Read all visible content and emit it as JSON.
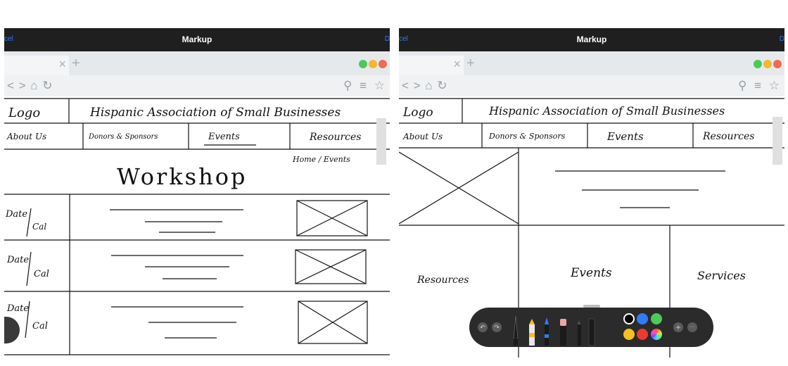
{
  "app_title": "Markup",
  "cancel_label": "cel",
  "done_label": "D",
  "colors": {
    "accent": "#2f7cf6",
    "topbar": "#1f1f1f",
    "tabstrip": "#e6e9ec"
  },
  "browser": {
    "tab_close": "×",
    "new_tab": "+",
    "nav_icons": "< > ⌂ ↻",
    "right_icons": "⚲ ≡ ☆",
    "window_dots": [
      "#4cc95a",
      "#f5b630",
      "#f06a55"
    ]
  },
  "left_wireframe": {
    "logo": "Logo",
    "site_title": "Hispanic Association of Small Businesses",
    "nav": [
      "About Us",
      "Donors & Sponsors",
      "Events",
      "Resources"
    ],
    "breadcrumb": "Home / Events",
    "page_heading": "Workshop",
    "rows": [
      {
        "date": "Date",
        "cal": "Cal"
      },
      {
        "date": "Date",
        "cal": "Cal"
      },
      {
        "date": "Date",
        "cal": "Cal"
      }
    ]
  },
  "right_wireframe": {
    "logo": "Logo",
    "site_title": "Hispanic Association of Small Businesses",
    "nav": [
      "About Us",
      "Donors & Sponsors",
      "Events",
      "Resources"
    ],
    "sections": [
      "Resources",
      "Events",
      "Services"
    ]
  },
  "markup_toolbar": {
    "undo": "↶",
    "redo": "↷",
    "add": "+",
    "more": "···",
    "tools": [
      "pen",
      "highlighter",
      "pencil",
      "eraser",
      "lasso",
      "ruler"
    ],
    "color_swatches": [
      "#000000",
      "#2f7cf6",
      "#4cc95a",
      "#f5c021",
      "#ec3a31",
      "multicolor"
    ]
  }
}
